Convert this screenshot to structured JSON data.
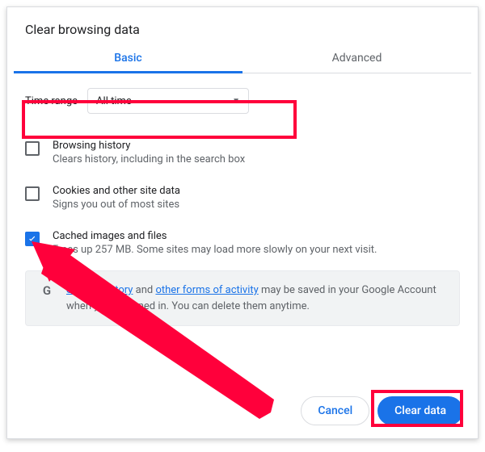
{
  "title": "Clear browsing data",
  "tabs": {
    "basic": "Basic",
    "advanced": "Advanced"
  },
  "time_range": {
    "label": "Time range",
    "value": "All time"
  },
  "options": [
    {
      "checked": false,
      "title": "Browsing history",
      "desc": "Clears history, including in the search box"
    },
    {
      "checked": false,
      "title": "Cookies and other site data",
      "desc": "Signs you out of most sites"
    },
    {
      "checked": true,
      "title": "Cached images and files",
      "desc": "Frees up 257 MB. Some sites may load more slowly on your next visit."
    }
  ],
  "note": {
    "link1": "Search history",
    "mid1": " and ",
    "link2": "other forms of activity",
    "mid2": " may be saved in your Google Account when you're signed in. You can delete them anytime."
  },
  "buttons": {
    "cancel": "Cancel",
    "clear": "Clear data"
  }
}
